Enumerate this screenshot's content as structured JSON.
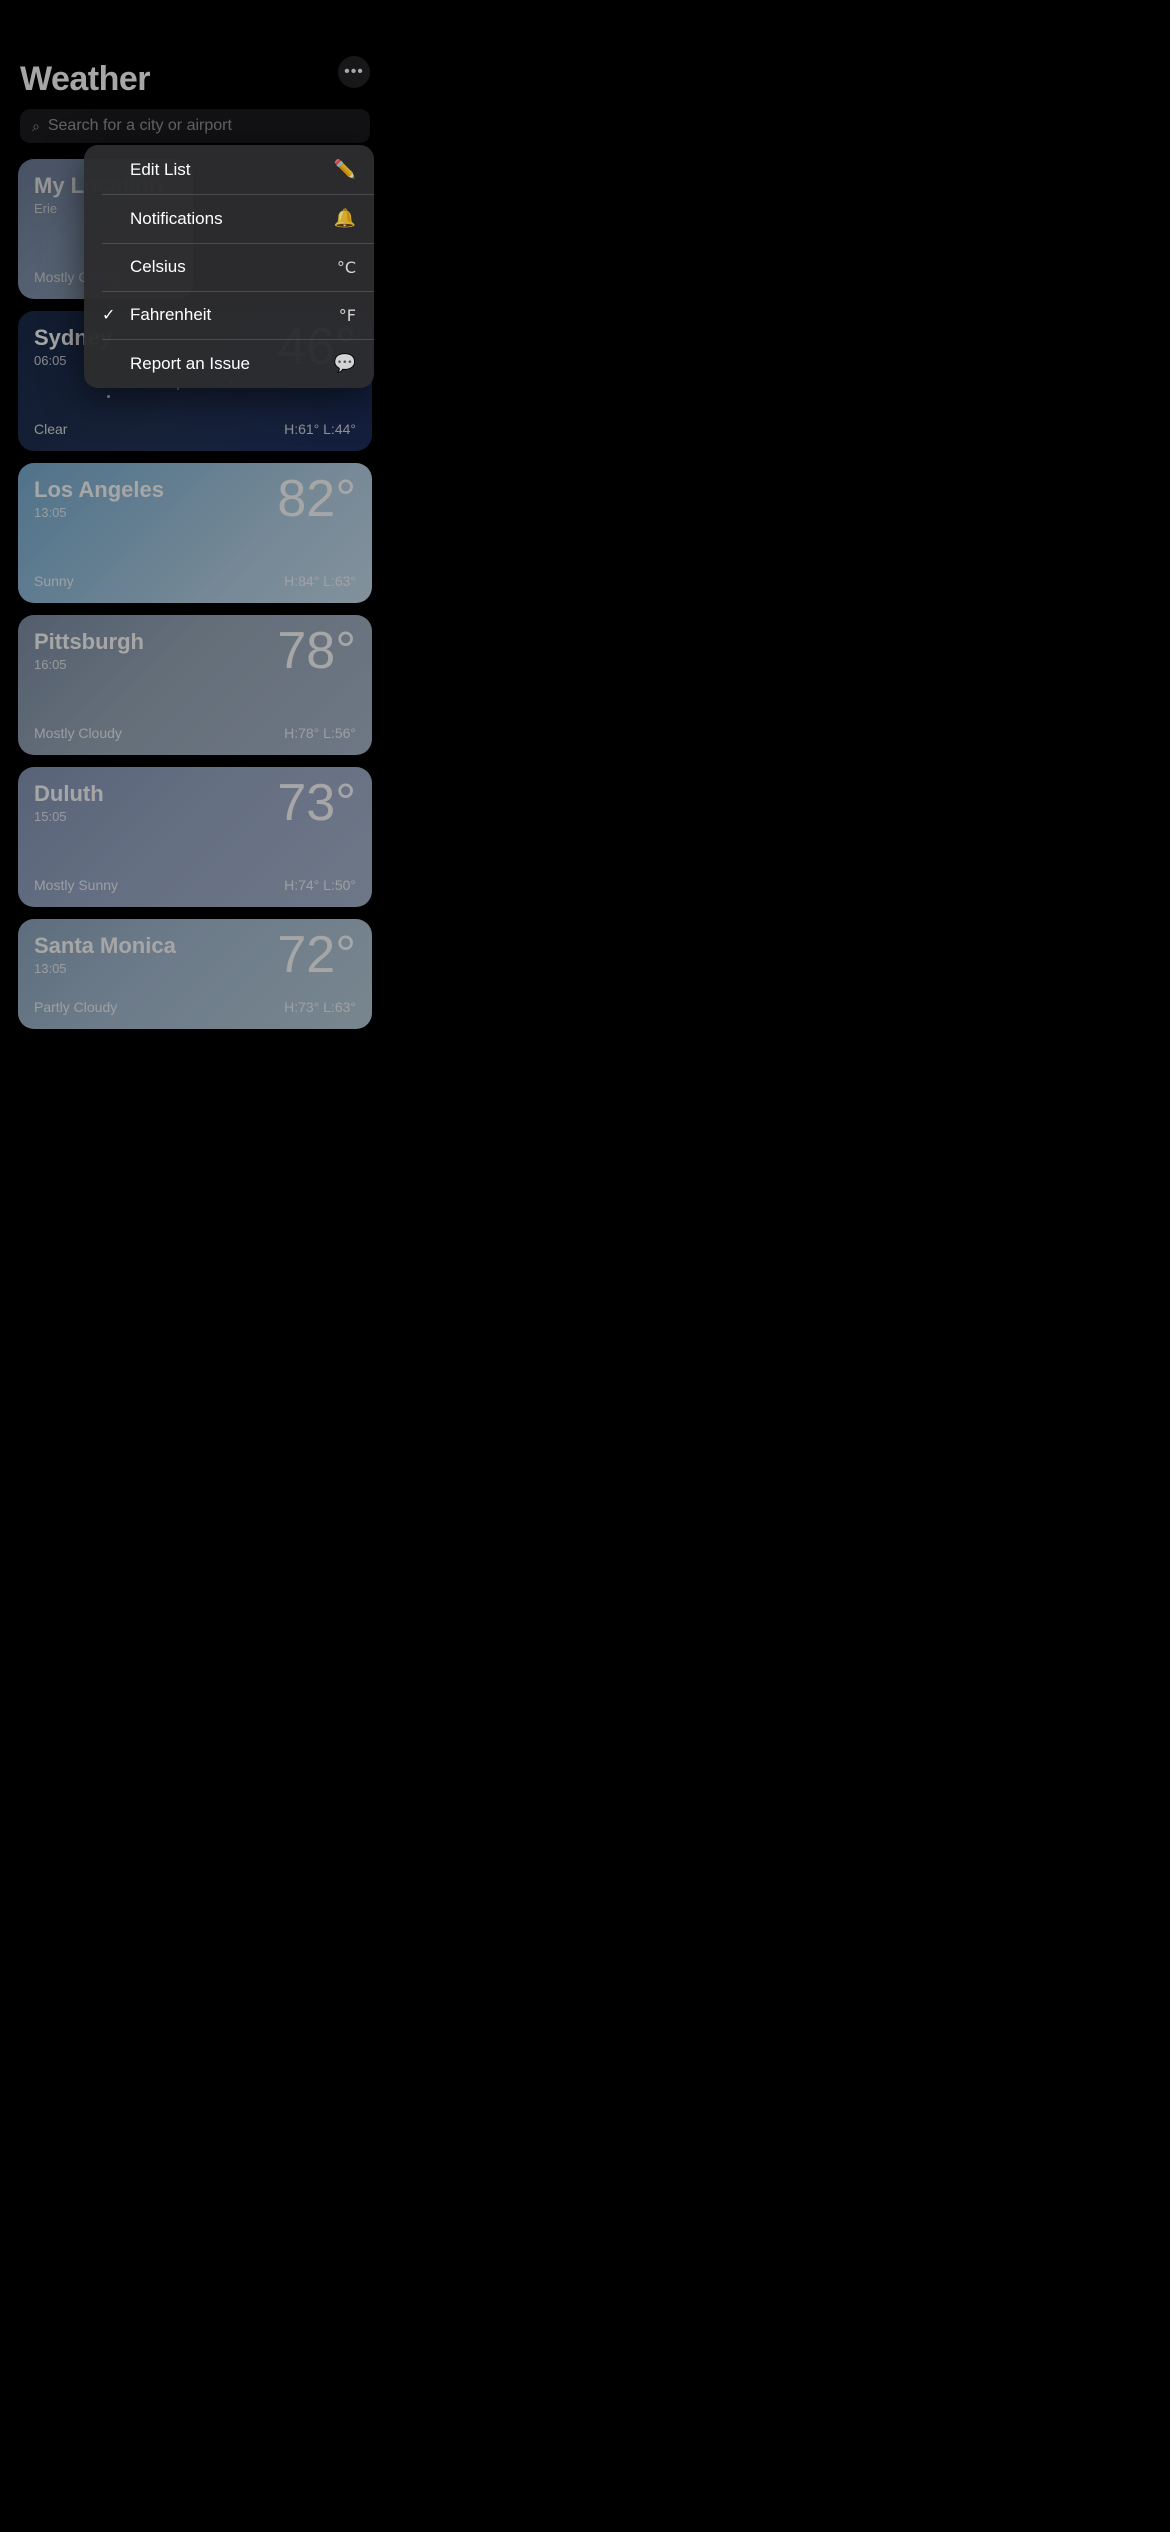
{
  "page": {
    "title": "Weather",
    "more_button_label": "···"
  },
  "search": {
    "placeholder": "Search for a city or airport"
  },
  "dropdown": {
    "items": [
      {
        "id": "edit-list",
        "label": "Edit List",
        "icon": "✏️",
        "checked": false
      },
      {
        "id": "notifications",
        "label": "Notifications",
        "icon": "🔔",
        "checked": false
      },
      {
        "id": "celsius",
        "label": "Celsius",
        "icon": "°C",
        "checked": false
      },
      {
        "id": "fahrenheit",
        "label": "Fahrenheit",
        "icon": "°F",
        "checked": true
      },
      {
        "id": "report-issue",
        "label": "Report an Issue",
        "icon": "💬",
        "checked": false
      }
    ]
  },
  "cards": [
    {
      "id": "my-location",
      "city": "My Location",
      "subtitle": "Erie",
      "time": "",
      "temp": "",
      "condition": "Mostly Cloudy",
      "high": "",
      "low": "",
      "partial": true
    },
    {
      "id": "sydney",
      "city": "Sydney",
      "subtitle": "",
      "time": "06:05",
      "temp": "46°",
      "condition": "Clear",
      "high": "61°",
      "low": "44°",
      "partial": false
    },
    {
      "id": "los-angeles",
      "city": "Los Angeles",
      "subtitle": "",
      "time": "13:05",
      "temp": "82°",
      "condition": "Sunny",
      "high": "84°",
      "low": "63°",
      "partial": false
    },
    {
      "id": "pittsburgh",
      "city": "Pittsburgh",
      "subtitle": "",
      "time": "16:05",
      "temp": "78°",
      "condition": "Mostly Cloudy",
      "high": "78°",
      "low": "56°",
      "partial": false
    },
    {
      "id": "duluth",
      "city": "Duluth",
      "subtitle": "",
      "time": "15:05",
      "temp": "73°",
      "condition": "Mostly Sunny",
      "high": "74°",
      "low": "50°",
      "partial": false
    },
    {
      "id": "santa-monica",
      "city": "Santa Monica",
      "subtitle": "",
      "time": "13:05",
      "temp": "72°",
      "condition": "Partly Cloudy",
      "high": "73°",
      "low": "63°",
      "partial": true
    }
  ]
}
